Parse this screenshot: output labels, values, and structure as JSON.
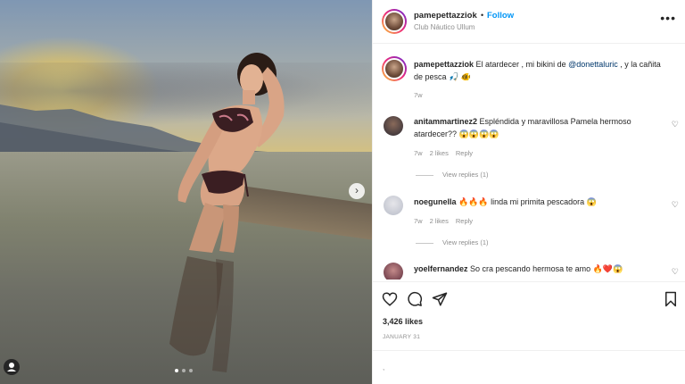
{
  "header": {
    "username": "pamepettazziok",
    "separator": "•",
    "follow_label": "Follow",
    "location": "Club Náutico Ullum",
    "more_label": "•••"
  },
  "caption": {
    "username": "pamepettazziok",
    "text_before": " El atardecer , mi bikini de ",
    "mention": "@donettaluric",
    "text_after": " , y la cañita de pesca 🎣 🐠",
    "time": "7w"
  },
  "comments": [
    {
      "username": "anitammartinez2",
      "text": " Espléndida y maravillosa Pamela hermoso atardecer?? 😱😱😱😱",
      "time": "7w",
      "likes": "2 likes",
      "reply_label": "Reply",
      "view_replies": "View replies (1)"
    },
    {
      "username": "noegunella",
      "text": " 🔥🔥🔥 linda mi primita pescadora 😱",
      "time": "7w",
      "likes": "2 likes",
      "reply_label": "Reply",
      "view_replies": "View replies (1)"
    },
    {
      "username": "yoelfernandez",
      "text": " So cra pescando hermosa te amo 🔥❤️😱"
    }
  ],
  "actions": {
    "likes_count": "3,426 likes",
    "date": "JANUARY 31",
    "comment_prompt": ","
  },
  "media": {
    "next_label": "›",
    "carousel_total": 3,
    "carousel_active": 1
  },
  "colors": {
    "follow": "#0095f6",
    "text": "#262626",
    "muted": "#8e8e8e",
    "mention": "#00376b"
  }
}
